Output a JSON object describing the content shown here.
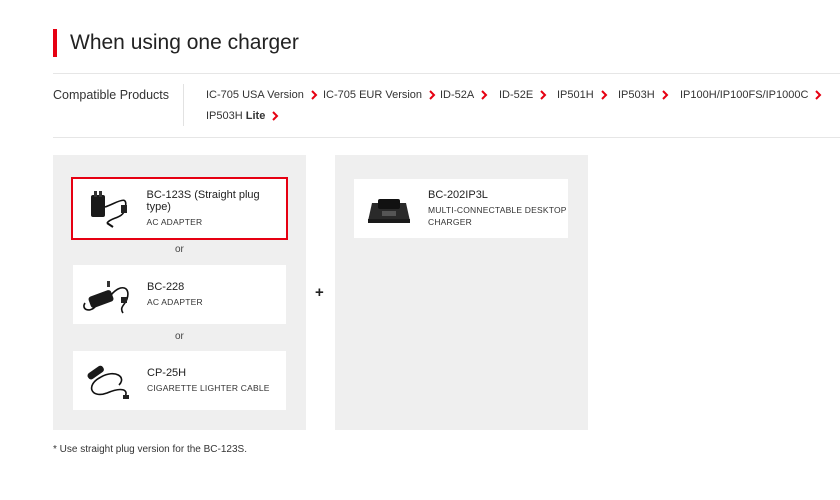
{
  "page": {
    "title": "When using one charger",
    "accent": "#e60012"
  },
  "compatible": {
    "label": "Compatible Products",
    "products": [
      {
        "name": "IC-705 USA Version",
        "bold": ""
      },
      {
        "name": "IC-705 EUR Version",
        "bold": ""
      },
      {
        "name": "ID-52A",
        "bold": ""
      },
      {
        "name": "ID-52E",
        "bold": ""
      },
      {
        "name": "IP501H",
        "bold": ""
      },
      {
        "name": "IP503H",
        "bold": ""
      },
      {
        "name": "IP100H/IP100FS/IP1000C",
        "bold": ""
      },
      {
        "name": "IP503H ",
        "bold": "Lite"
      }
    ]
  },
  "left_options": [
    {
      "name": "BC-123S (Straight plug type)",
      "desc": "AC ADAPTER",
      "icon": "ac-adapter-icon",
      "selected": true
    },
    {
      "name": "BC-228",
      "desc": "AC ADAPTER",
      "icon": "ac-adapter-icon",
      "selected": false
    },
    {
      "name": "CP-25H",
      "desc": "CIGARETTE LIGHTER CABLE",
      "icon": "cigarette-cable-icon",
      "selected": false
    }
  ],
  "separators": {
    "or_1": "or",
    "or_2": "or",
    "plus": "+"
  },
  "right_options": [
    {
      "name": "BC-202IP3L",
      "desc_line1": "MULTI-CONNECTABLE DESKTOP",
      "desc_line2": "CHARGER",
      "icon": "desktop-charger-icon"
    }
  ],
  "footnote": "* Use straight plug version for the BC-123S."
}
